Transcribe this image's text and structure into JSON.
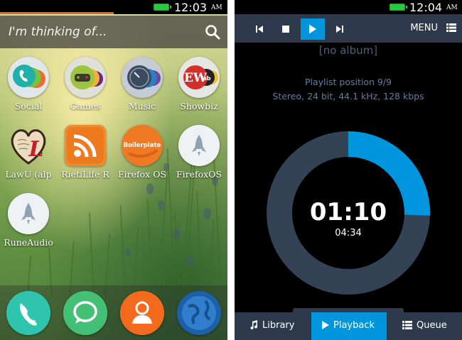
{
  "left_phone": {
    "status": {
      "time": "12:03",
      "ampm": "AM",
      "battery_color": "#27c93f"
    },
    "search": {
      "placeholder": "I'm thinking of..."
    },
    "apps": [
      {
        "label": "Social",
        "icon": "social-icon"
      },
      {
        "label": "Games",
        "icon": "games-icon"
      },
      {
        "label": "Music",
        "icon": "music-icon"
      },
      {
        "label": "Showbiz",
        "icon": "showbiz-icon"
      },
      {
        "label": "LawU (alp",
        "icon": "lawu-icon"
      },
      {
        "label": "RietiLife R",
        "icon": "rss-icon"
      },
      {
        "label": "Firefox OS",
        "icon": "boilerplate-icon",
        "icon_text": "Boilerplate"
      },
      {
        "label": "FirefoxOS",
        "icon": "rocket-icon"
      },
      {
        "label": "RuneAudio",
        "icon": "rocket-icon"
      }
    ],
    "dock": [
      {
        "name": "phone",
        "icon": "phone-icon"
      },
      {
        "name": "messages",
        "icon": "chat-icon"
      },
      {
        "name": "contacts",
        "icon": "contacts-icon"
      },
      {
        "name": "browser",
        "icon": "globe-icon"
      }
    ]
  },
  "right_phone": {
    "status": {
      "time": "12:04",
      "ampm": "AM",
      "battery_color": "#27c93f"
    },
    "toolbar": {
      "menu_label": "MENU"
    },
    "album": "[no album]",
    "playlist_position": "Playlist position 9/9",
    "format": "Stereo, 24 bit, 44.1 kHz, 128 kbps",
    "elapsed": "01:10",
    "total": "04:34",
    "progress_fraction": 0.255,
    "colors": {
      "accent": "#0095dd",
      "ring_track": "#344256",
      "bar": "#2e3a4c"
    },
    "tabs": [
      {
        "label": "Library",
        "icon": "music-note-icon",
        "active": false
      },
      {
        "label": "Playback",
        "icon": "play-icon",
        "active": true
      },
      {
        "label": "Queue",
        "icon": "list-icon",
        "active": false
      }
    ]
  }
}
